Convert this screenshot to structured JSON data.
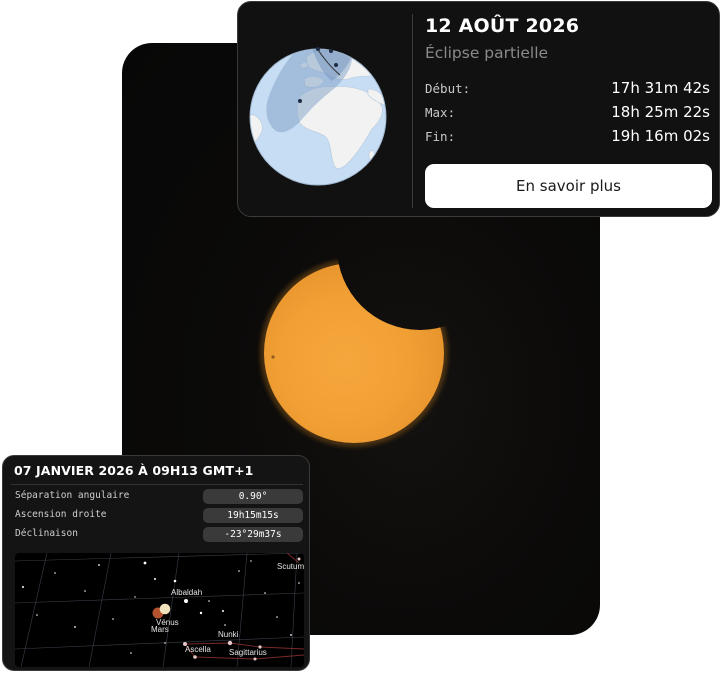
{
  "eclipse_card": {
    "date": "12 AOÛT 2026",
    "type": "Éclipse partielle",
    "times": [
      {
        "label": "Début:",
        "value": "17h 31m 42s"
      },
      {
        "label": "Max:",
        "value": "18h 25m 22s"
      },
      {
        "label": "Fin:",
        "value": "19h 16m 02s"
      }
    ],
    "button_label": "En savoir plus",
    "globe_icon": "globe-map-icon"
  },
  "conjunction_card": {
    "title": "07 JANVIER 2026 À 09H13 GMT+1",
    "rows": [
      {
        "label": "Séparation angulaire",
        "value": "0.90°"
      },
      {
        "label": "Ascension droite",
        "value": "19h15m15s"
      },
      {
        "label": "Déclinaison",
        "value": "-23°29m37s"
      }
    ],
    "sky_labels": {
      "scutum": "Scutum",
      "albaldah": "Albaldah",
      "venus": "Vénus",
      "mars": "Mars",
      "nunki": "Nunki",
      "ascella": "Ascella",
      "sagittarius": "Sagittarius"
    }
  },
  "photo": {
    "subject": "partial-solar-eclipse",
    "sun_color": "#f3a23a",
    "background_color": "#0b0a09"
  },
  "colors": {
    "card_background": "#111111",
    "ocean": "#c7ddf3",
    "land": "#f2f2f2",
    "eclipse_zone": "#7d9fc6",
    "button_background": "#ffffff"
  }
}
